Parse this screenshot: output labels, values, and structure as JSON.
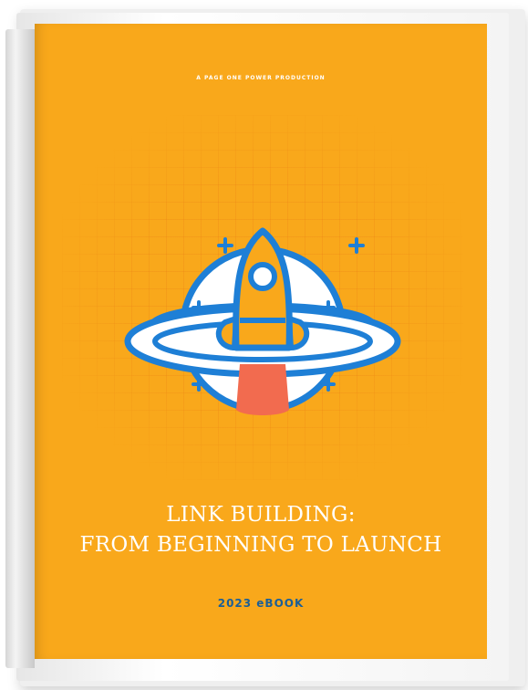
{
  "cover": {
    "kicker": "A PAGE ONE POWER PRODUCTION",
    "title_line_1": "LINK BUILDING:",
    "title_line_2": "FROM BEGINNING TO LAUNCH",
    "edition": "2023 eBOOK"
  },
  "emblem": {
    "icon": "rocket-planet-icon",
    "sparkle_icon": "plus-icon"
  },
  "colors": {
    "cover_background": "#f9a81b",
    "outline_blue": "#1e7fd6",
    "flame": "#f26b4f",
    "edition_text": "#1c5f96",
    "title_text": "#ffffff"
  }
}
